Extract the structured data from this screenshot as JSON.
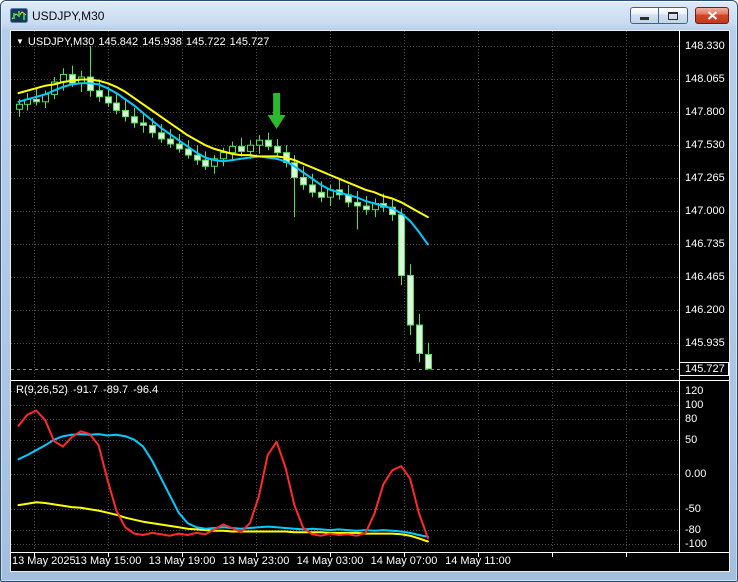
{
  "window": {
    "title": "USDJPY,M30",
    "controls": {
      "minimize": "minimize-icon",
      "maximize": "maximize-icon",
      "close": "close-icon"
    }
  },
  "chart": {
    "header": {
      "dropdown_icon": "▼",
      "symbol": "USDJPY,M30",
      "open": "145.842",
      "high": "145.938",
      "low": "145.722",
      "close": "145.727"
    },
    "price_axis": [
      "148.330",
      "148.065",
      "147.800",
      "147.530",
      "147.265",
      "147.000",
      "146.735",
      "146.465",
      "146.200",
      "145.935"
    ],
    "current_price": "145.727",
    "time_axis": [
      "13 May 2025",
      "13 May 15:00",
      "13 May 19:00",
      "13 May 23:00",
      "14 May 03:00",
      "14 May 07:00",
      "14 May 11:00"
    ]
  },
  "indicator": {
    "label": "R(9,26,52)",
    "values": [
      "-91.7",
      "-89.7",
      "-96.4"
    ],
    "axis": [
      "120",
      "100",
      "80",
      "50",
      "0.00",
      "-50",
      "-80",
      "-100"
    ]
  },
  "colors": {
    "background": "#000000",
    "grid": "#4d4d4d",
    "axis_text": "#ffffff",
    "candle_outline": "#54e054",
    "candle_bear_fill": "#d9f7d9",
    "candle_bull_fill": "#000000",
    "ma_slow": "#ffff00",
    "ma_fast": "#00ccff",
    "indicator_red": "#ff2a2a",
    "indicator_cyan": "#00ccff",
    "indicator_yellow": "#ffff00",
    "arrow_green": "#2db92d",
    "separator": "#ffffff"
  },
  "chart_data": {
    "type": "candlestick",
    "title": "USDJPY,M30",
    "symbol": "USDJPY",
    "timeframe": "M30",
    "ylabel_levels": [
      148.33,
      148.065,
      147.8,
      147.53,
      147.265,
      147.0,
      146.735,
      146.465,
      146.2,
      145.935
    ],
    "current_price": 145.727,
    "x_axis_labels": [
      "13 May 2025",
      "13 May 15:00",
      "13 May 19:00",
      "13 May 23:00",
      "14 May 03:00",
      "14 May 07:00",
      "14 May 11:00"
    ],
    "candles_ohlc": [
      [
        147.82,
        147.9,
        147.76,
        147.86
      ],
      [
        147.86,
        147.95,
        147.81,
        147.9
      ],
      [
        147.9,
        147.99,
        147.85,
        147.88
      ],
      [
        147.88,
        147.97,
        147.83,
        147.94
      ],
      [
        147.94,
        148.08,
        147.9,
        148.04
      ],
      [
        148.04,
        148.15,
        147.97,
        148.1
      ],
      [
        148.1,
        148.17,
        148.0,
        148.03
      ],
      [
        148.03,
        148.13,
        147.96,
        148.08
      ],
      [
        148.08,
        148.33,
        147.92,
        147.97
      ],
      [
        147.97,
        148.06,
        147.88,
        147.92
      ],
      [
        147.92,
        148.0,
        147.84,
        147.87
      ],
      [
        147.87,
        147.94,
        147.78,
        147.81
      ],
      [
        147.81,
        147.89,
        147.72,
        147.76
      ],
      [
        147.76,
        147.83,
        147.67,
        147.71
      ],
      [
        147.71,
        147.79,
        147.63,
        147.69
      ],
      [
        147.69,
        147.75,
        147.59,
        147.63
      ],
      [
        147.63,
        147.7,
        147.55,
        147.58
      ],
      [
        147.58,
        147.66,
        147.51,
        147.54
      ],
      [
        147.54,
        147.62,
        147.47,
        147.5
      ],
      [
        147.5,
        147.57,
        147.42,
        147.45
      ],
      [
        147.45,
        147.53,
        147.37,
        147.41
      ],
      [
        147.41,
        147.48,
        147.33,
        147.36
      ],
      [
        147.36,
        147.45,
        147.3,
        147.42
      ],
      [
        147.42,
        147.51,
        147.36,
        147.47
      ],
      [
        147.47,
        147.56,
        147.41,
        147.52
      ],
      [
        147.52,
        147.59,
        147.44,
        147.48
      ],
      [
        147.48,
        147.57,
        147.42,
        147.53
      ],
      [
        147.53,
        147.61,
        147.46,
        147.57
      ],
      [
        147.57,
        147.63,
        147.49,
        147.52
      ],
      [
        147.52,
        147.58,
        147.43,
        147.47
      ],
      [
        147.47,
        147.53,
        147.35,
        147.39
      ],
      [
        147.39,
        147.45,
        146.95,
        147.27
      ],
      [
        147.27,
        147.36,
        147.17,
        147.21
      ],
      [
        147.21,
        147.3,
        147.11,
        147.15
      ],
      [
        147.15,
        147.24,
        147.07,
        147.11
      ],
      [
        147.11,
        147.21,
        147.04,
        147.17
      ],
      [
        147.17,
        147.26,
        147.09,
        147.13
      ],
      [
        147.13,
        147.21,
        147.03,
        147.07
      ],
      [
        147.07,
        147.16,
        146.85,
        147.04
      ],
      [
        147.04,
        147.12,
        146.97,
        147.01
      ],
      [
        147.01,
        147.1,
        146.95,
        147.06
      ],
      [
        147.06,
        147.14,
        146.99,
        147.03
      ],
      [
        147.03,
        147.09,
        146.92,
        146.97
      ],
      [
        146.97,
        147.02,
        146.4,
        146.48
      ],
      [
        146.48,
        146.57,
        146.0,
        146.08
      ],
      [
        146.08,
        146.17,
        145.78,
        145.85
      ],
      [
        145.842,
        145.938,
        145.722,
        145.727
      ]
    ],
    "overlays": {
      "ma_yellow": [
        147.95,
        147.97,
        147.99,
        148.01,
        148.02,
        148.04,
        148.05,
        148.06,
        148.06,
        148.05,
        148.03,
        148.0,
        147.96,
        147.91,
        147.86,
        147.81,
        147.76,
        147.71,
        147.66,
        147.61,
        147.57,
        147.53,
        147.5,
        147.48,
        147.46,
        147.45,
        147.45,
        147.44,
        147.44,
        147.44,
        147.43,
        147.41,
        147.38,
        147.35,
        147.32,
        147.29,
        147.26,
        147.23,
        147.2,
        147.17,
        147.15,
        147.12,
        147.1,
        147.07,
        147.03,
        146.99,
        146.95
      ],
      "ma_cyan": [
        147.88,
        147.9,
        147.92,
        147.94,
        147.97,
        148.0,
        148.02,
        148.03,
        148.03,
        148.02,
        147.99,
        147.95,
        147.9,
        147.85,
        147.79,
        147.73,
        147.67,
        147.62,
        147.57,
        147.52,
        147.47,
        147.43,
        147.41,
        147.4,
        147.41,
        147.42,
        147.43,
        147.44,
        147.43,
        147.42,
        147.4,
        147.36,
        147.31,
        147.26,
        147.21,
        147.17,
        147.15,
        147.13,
        147.11,
        147.08,
        147.06,
        147.04,
        147.02,
        146.98,
        146.92,
        146.83,
        146.73
      ]
    },
    "marker": {
      "type": "arrow-down",
      "bar_index": 29
    },
    "indicator_panel": {
      "name": "R(9,26,52)",
      "levels": [
        120,
        100,
        80,
        50,
        0,
        -50,
        -80,
        -100
      ],
      "last_values": [
        -91.7,
        -89.7,
        -96.4
      ],
      "series": [
        {
          "name": "red",
          "values": [
            70,
            86,
            92,
            78,
            48,
            40,
            54,
            62,
            58,
            42,
            -8,
            -52,
            -76,
            -85,
            -87,
            -84,
            -86,
            -88,
            -85,
            -87,
            -84,
            -86,
            -79,
            -72,
            -77,
            -83,
            -70,
            -32,
            28,
            47,
            10,
            -44,
            -77,
            -86,
            -88,
            -85,
            -87,
            -86,
            -88,
            -84,
            -56,
            -14,
            6,
            12,
            -6,
            -56,
            -91.7
          ]
        },
        {
          "name": "cyan",
          "values": [
            22,
            28,
            35,
            42,
            50,
            55,
            57,
            58,
            57,
            58,
            56,
            57,
            55,
            50,
            40,
            20,
            -5,
            -30,
            -55,
            -70,
            -76,
            -78,
            -77,
            -76,
            -77,
            -78,
            -77,
            -76,
            -75,
            -76,
            -77,
            -78,
            -79,
            -78,
            -79,
            -80,
            -79,
            -80,
            -81,
            -80,
            -81,
            -80,
            -81,
            -82,
            -84,
            -87,
            -89.7
          ]
        },
        {
          "name": "yellow",
          "values": [
            -44,
            -42,
            -40,
            -41,
            -43,
            -45,
            -47,
            -48,
            -50,
            -52,
            -55,
            -58,
            -62,
            -65,
            -68,
            -70,
            -72,
            -74,
            -76,
            -78,
            -79,
            -80,
            -81,
            -81,
            -82,
            -82,
            -82,
            -82,
            -82,
            -82,
            -82,
            -83,
            -83,
            -83,
            -83,
            -84,
            -84,
            -84,
            -84,
            -85,
            -85,
            -85,
            -85,
            -86,
            -88,
            -92,
            -96.4
          ]
        }
      ]
    }
  }
}
